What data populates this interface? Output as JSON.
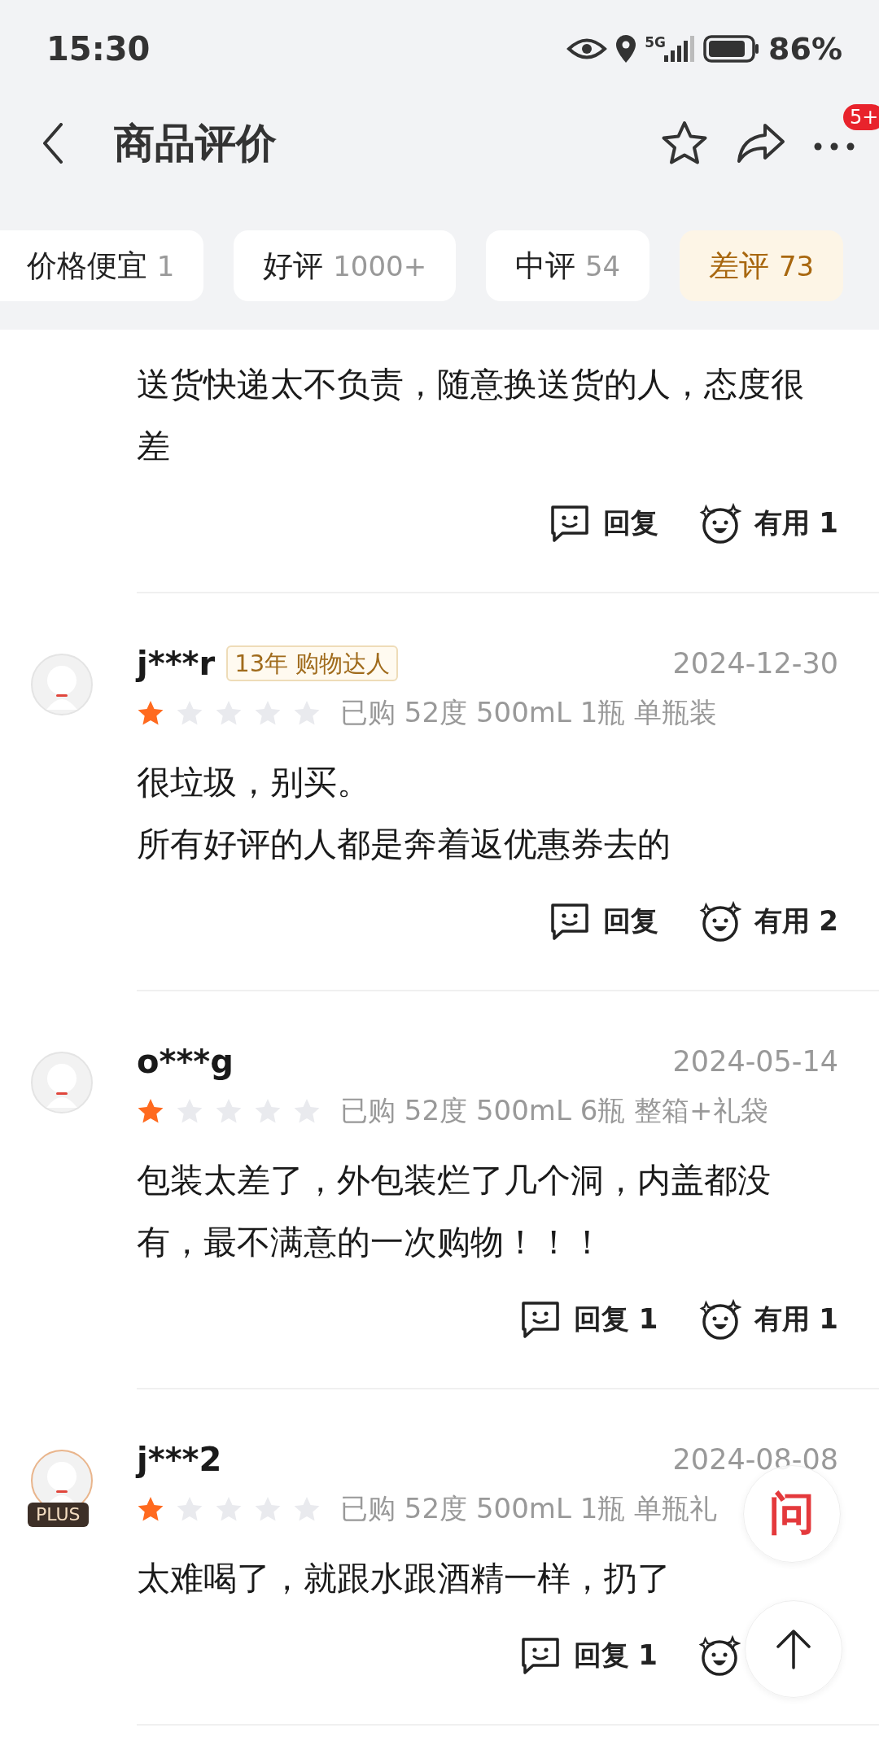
{
  "status_bar": {
    "time": "15:30",
    "network": "5G",
    "battery": "86%"
  },
  "header": {
    "title": "商品评价",
    "notification_badge": "5+"
  },
  "tabs": [
    {
      "label": "价格便宜",
      "count": "1",
      "selected": false
    },
    {
      "label": "好评",
      "count": "1000+",
      "selected": false
    },
    {
      "label": "中评",
      "count": "54",
      "selected": false
    },
    {
      "label": "差评",
      "count": "73",
      "selected": true
    }
  ],
  "reviews": [
    {
      "paragraphs": [
        "送货快递太不负责，随意换送货的人，态度很差"
      ],
      "reply": "回复",
      "useful": "有用 1"
    },
    {
      "avatar": {
        "kind": "plain"
      },
      "user": "j***r",
      "badge": "13年 购物达人",
      "date": "2024-12-30",
      "stars": 1,
      "spec": "已购 52度 500mL 1瓶 单瓶装",
      "paragraphs": [
        "很垃圾，别买。",
        "所有好评的人都是奔着返优惠券去的"
      ],
      "reply": "回复",
      "useful": "有用 2"
    },
    {
      "avatar": {
        "kind": "plain"
      },
      "user": "o***g",
      "date": "2024-05-14",
      "stars": 1,
      "spec": "已购 52度 500mL 6瓶 整箱+礼袋",
      "paragraphs": [
        "包装太差了，外包装烂了几个洞，内盖都没有，最不满意的一次购物！！！"
      ],
      "reply": "回复 1",
      "useful": "有用 1"
    },
    {
      "avatar": {
        "kind": "plus",
        "label": "PLUS"
      },
      "user": "j***2",
      "date": "2024-08-08",
      "stars": 1,
      "spec": "已购 52度 500mL 1瓶 单瓶礼",
      "paragraphs": [
        "太难喝了，就跟水跟酒精一样，扔了"
      ],
      "reply": "回复 1"
    }
  ],
  "floating": {
    "ask": "问"
  }
}
